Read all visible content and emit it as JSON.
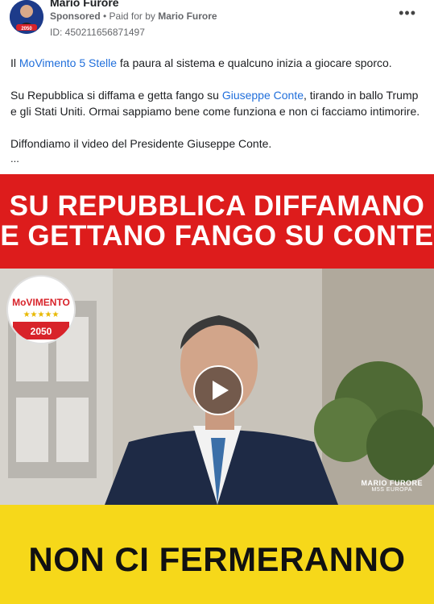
{
  "header": {
    "author": "Mario Furore",
    "sponsored": "Sponsored",
    "separator": " • ",
    "paid_for_label": "Paid for by ",
    "paid_for_name": "Mario Furore",
    "ad_id": "ID: 450211656871497",
    "more_icon": "•••"
  },
  "post": {
    "p1_pre": "Il ",
    "p1_link": "MoVimento 5 Stelle",
    "p1_post": " fa paura al sistema e qualcuno inizia a giocare sporco.",
    "p2_pre": "Su Repubblica si diffama e getta fango su ",
    "p2_link": "Giuseppe Conte",
    "p2_post": ", tirando in ballo Trump e gli Stati Uniti. Ormai sappiamo bene come funziona e non ci facciamo intimorire.",
    "p3": "Diffondiamo il video del Presidente Giuseppe Conte.",
    "ellipsis": "..."
  },
  "media": {
    "headline_1": "SU REPUBBLICA DIFFAMANO",
    "headline_2": "E GETTANO FANGO SU CONTE",
    "bottom": "NON CI FERMERANNO",
    "logo_word": "MoVIMENTO",
    "logo_year": "2050",
    "watermark_name": "MARIO FURORE",
    "watermark_sub": "M5S EUROPA"
  },
  "colors": {
    "red": "#dd1c1c",
    "yellow": "#f6d81a",
    "link": "#216fdb"
  }
}
